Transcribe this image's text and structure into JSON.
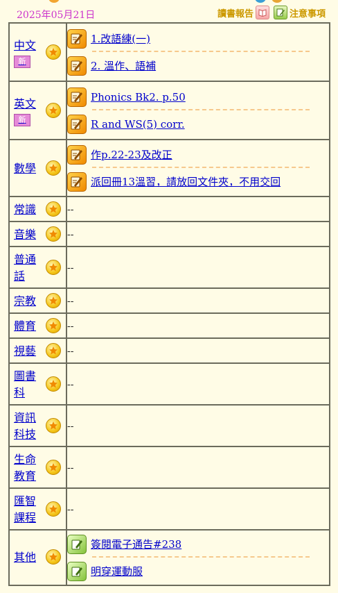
{
  "header": {
    "date": "2025年05月21日",
    "reading_report_label": "讀書報告",
    "notice_label": "注意事項"
  },
  "subjects": [
    {
      "name": "中文",
      "new": "新",
      "items": [
        "1.改語練(一)",
        "2. 溫作、語補"
      ]
    },
    {
      "name": "英文",
      "new": "新",
      "items": [
        "Phonics Bk2. p.50",
        "R and WS(5) corr."
      ]
    },
    {
      "name": "數學",
      "items": [
        "作p.22-23及改正",
        "派回冊13溫習，請放回文件夾，不用交回"
      ]
    },
    {
      "name": "常識",
      "empty": "--"
    },
    {
      "name": "音樂",
      "empty": "--"
    },
    {
      "name": "普通話",
      "empty": "--"
    },
    {
      "name": "宗教",
      "empty": "--"
    },
    {
      "name": "體育",
      "empty": "--"
    },
    {
      "name": "視藝",
      "empty": "--"
    },
    {
      "name": "圖書科",
      "empty": "--"
    },
    {
      "name": "資訊科技",
      "empty": "--"
    },
    {
      "name": "生命教育",
      "empty": "--"
    },
    {
      "name": "匯智課程",
      "empty": "--"
    },
    {
      "name": "其他",
      "items": [
        "簽閱電子通告#238",
        "明穿運動服"
      ]
    }
  ],
  "icons": {
    "star": "star-icon",
    "homework": "pencil-icon",
    "notice": "notice-pen-icon",
    "reading": "book-icon"
  },
  "colors": {
    "background": "#fffce6",
    "date": "#cc33cc",
    "link": "#0000cc",
    "toplinks": "#cc9900",
    "border": "#6b6b5c",
    "new_badge": "#e58ad8",
    "dashed": "#f6c88c"
  }
}
